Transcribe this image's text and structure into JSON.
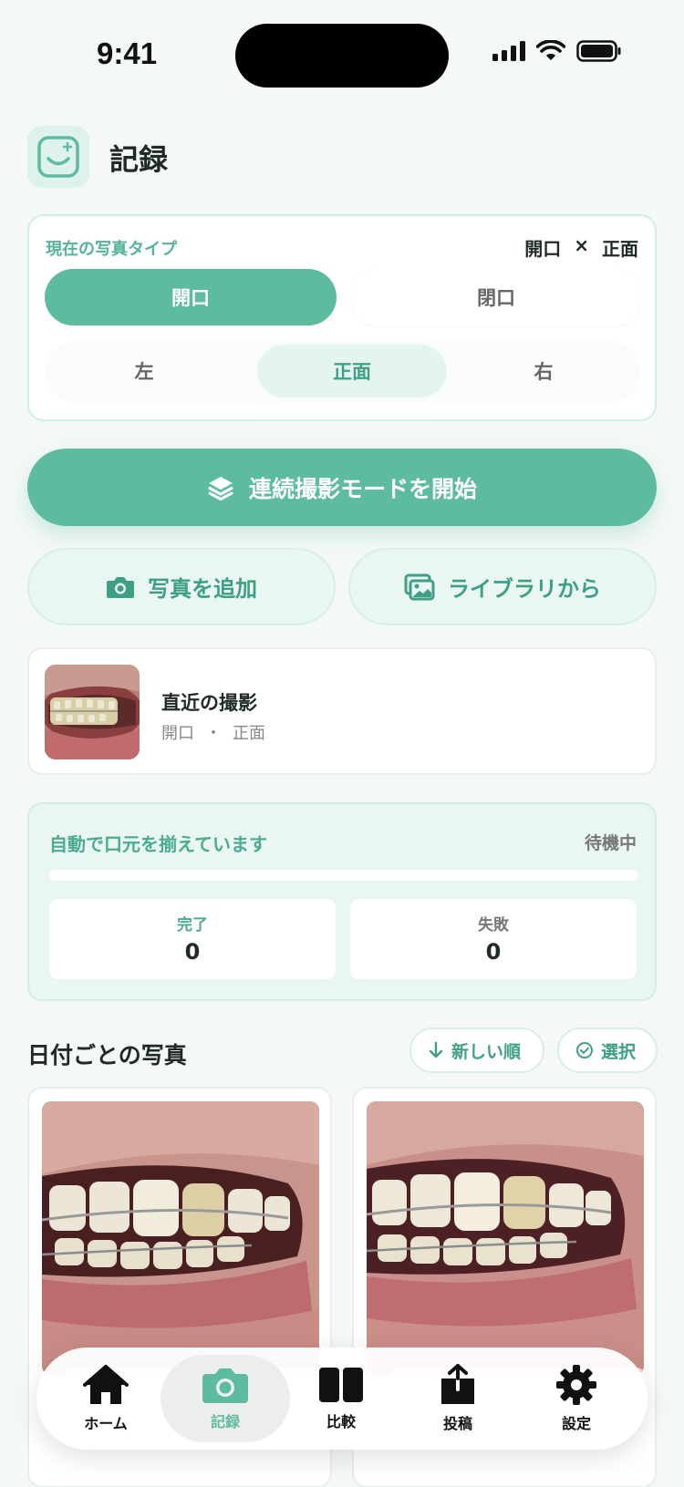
{
  "status_bar": {
    "time": "9:41"
  },
  "header": {
    "title": "記録"
  },
  "type_card": {
    "label": "現在の写真タイプ",
    "current_mouth": "開口",
    "current_separator": "×",
    "current_position": "正面",
    "mouth_options": [
      "開口",
      "閉口"
    ],
    "position_options": [
      "左",
      "正面",
      "右"
    ]
  },
  "actions": {
    "burst_label": "連続撮影モードを開始",
    "add_photo_label": "写真を追加",
    "library_label": "ライブラリから"
  },
  "recent": {
    "title": "直近の撮影",
    "mouth": "開口",
    "dot": "・",
    "position": "正面"
  },
  "align": {
    "title": "自動で口元を揃えています",
    "status": "待機中",
    "progress": 0,
    "done_label": "完了",
    "done_value": "0",
    "fail_label": "失敗",
    "fail_value": "0"
  },
  "dates": {
    "title": "日付ごとの写真",
    "sort_label": "新しい順",
    "select_label": "選択"
  },
  "tabs": {
    "home": "ホーム",
    "record": "記録",
    "compare": "比較",
    "post": "投稿",
    "settings": "設定"
  },
  "colors": {
    "accent": "#5dbba0",
    "accent_dark": "#3f9f86",
    "accent_light": "#e9f6f2"
  }
}
